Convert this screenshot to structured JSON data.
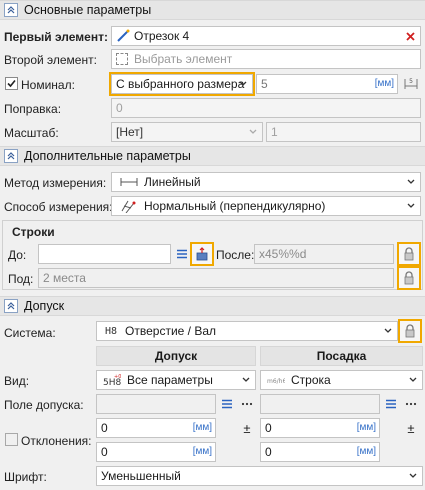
{
  "sections": {
    "main": "Основные параметры",
    "additional": "Дополнительные параметры",
    "tolerance": "Допуск"
  },
  "main": {
    "first_label": "Первый элемент:",
    "first_value": "Отрезок 4",
    "second_label": "Второй элемент:",
    "second_placeholder": "Выбрать элемент",
    "nominal_label": "Номинал:",
    "nominal_checked": true,
    "nominal_mode": "С выбранного размера",
    "nominal_value": "5",
    "nominal_unit": "[мм]",
    "correction_label": "Поправка:",
    "correction_value": "0",
    "scale_label": "Масштаб:",
    "scale_value": "[Нет]",
    "scale_factor": "1"
  },
  "additional": {
    "method_label": "Метод измерения:",
    "method_value": "Линейный",
    "way_label": "Способ измерения:",
    "way_value": "Нормальный (перпендикулярно)",
    "strings_title": "Строки",
    "before_label": "До:",
    "before_value": "",
    "after_label": "После:",
    "after_value": "x45%%d",
    "under_label": "Под:",
    "under_value": "2 места"
  },
  "tolerance": {
    "system_label": "Система:",
    "system_icon_text": "H8",
    "system_value": "Отверстие / Вал",
    "col_hole": "Допуск",
    "col_shaft": "Посадка",
    "view_label": "Вид:",
    "view_hole_value": "Все параметры",
    "view_shaft_value": "Строка",
    "field_label": "Поле допуска:",
    "dev_label": "Отклонения:",
    "dev_upper_hole": "0",
    "dev_lower_hole": "0",
    "dev_upper_shaft": "0",
    "dev_lower_shaft": "0",
    "unit": "[мм]",
    "pm": "±",
    "font_label": "Шрифт:",
    "font_value": "Уменьшенный"
  },
  "colors": {
    "highlight": "#f0a800",
    "accent": "#3570c8",
    "clear_red": "#d02020"
  }
}
